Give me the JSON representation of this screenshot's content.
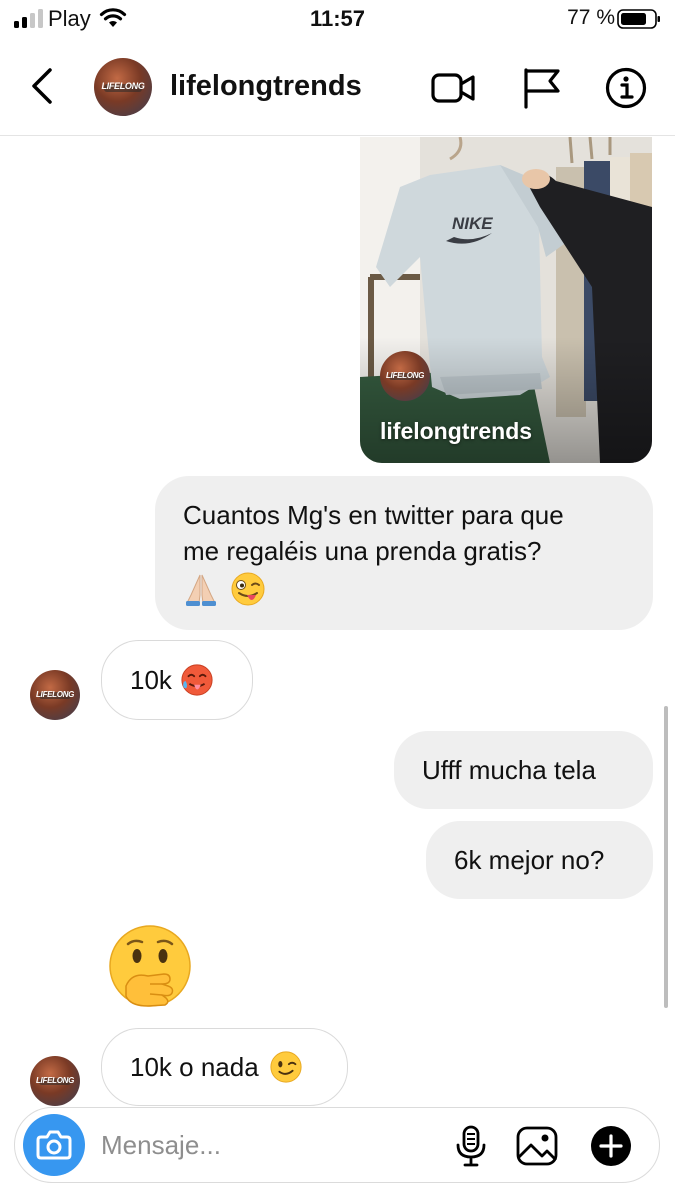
{
  "status_bar": {
    "carrier": "Play",
    "time": "11:57",
    "battery": "77 %",
    "signal_bars": 2,
    "battery_level": 0.77
  },
  "header": {
    "username": "lifelongtrends",
    "avatar_text": "LIFELONG",
    "icons": [
      "back-icon",
      "video-call-icon",
      "flag-icon",
      "info-icon"
    ]
  },
  "shared_post": {
    "username": "lifelongtrends",
    "avatar_text": "LIFELONG",
    "shirt_brand": "NIKE"
  },
  "messages": [
    {
      "from": "me",
      "lines": [
        "Cuantos Mg's en twitter para que",
        "me regaléis una prenda gratis?"
      ],
      "emojis": [
        "folded-hands",
        "winking-tongue-face"
      ]
    },
    {
      "from": "them",
      "text": "10k",
      "emoji": "hot-face"
    },
    {
      "from": "me",
      "text": "Ufff mucha tela"
    },
    {
      "from": "me",
      "text": "6k mejor no?"
    },
    {
      "from": "them",
      "emoji": "face-with-hand-over-mouth"
    },
    {
      "from": "them",
      "text": "10k o nada",
      "emoji": "winking-face"
    }
  ],
  "composer": {
    "placeholder": "Mensaje...",
    "icons": [
      "camera-icon",
      "microphone-icon",
      "gallery-icon",
      "add-icon"
    ]
  },
  "colors": {
    "accent": "#3797f0",
    "outgoing_bubble": "#efefef",
    "incoming_border": "#dadada",
    "text": "#111111"
  }
}
